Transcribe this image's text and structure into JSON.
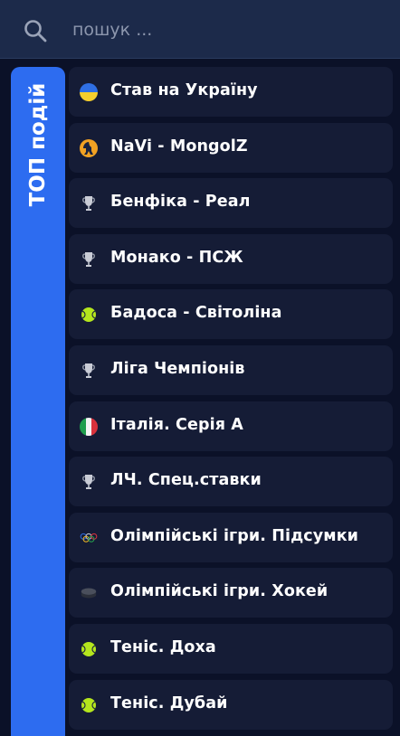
{
  "search": {
    "placeholder": "пошук ..."
  },
  "top_tab": {
    "label": "ТОП подій"
  },
  "items": [
    {
      "label": "Став на Україну",
      "icon": "ukraine-flag-icon"
    },
    {
      "label": "NaVi - MongolZ",
      "icon": "counter-strike-icon"
    },
    {
      "label": "Бенфіка - Реал",
      "icon": "trophy-icon"
    },
    {
      "label": "Монако - ПСЖ",
      "icon": "trophy-icon"
    },
    {
      "label": "Бадоса - Світоліна",
      "icon": "tennis-ball-icon"
    },
    {
      "label": "Ліга Чемпіонів",
      "icon": "trophy-icon"
    },
    {
      "label": "Італія. Серія А",
      "icon": "italy-flag-icon"
    },
    {
      "label": "ЛЧ. Спец.ставки",
      "icon": "trophy-icon"
    },
    {
      "label": "Олімпійські ігри. Підсумки",
      "icon": "olympic-rings-icon"
    },
    {
      "label": "Олімпійські ігри. Хокей",
      "icon": "hockey-puck-icon"
    },
    {
      "label": "Теніс. Доха",
      "icon": "tennis-ball-icon"
    },
    {
      "label": "Теніс. Дубай",
      "icon": "tennis-ball-icon"
    }
  ],
  "colors": {
    "background": "#0b1128",
    "search_bar": "#1c2a4a",
    "item_bg": "#151c36",
    "accent_tab": "#2d6cf0",
    "tennis_ball": "#b5e61d"
  }
}
